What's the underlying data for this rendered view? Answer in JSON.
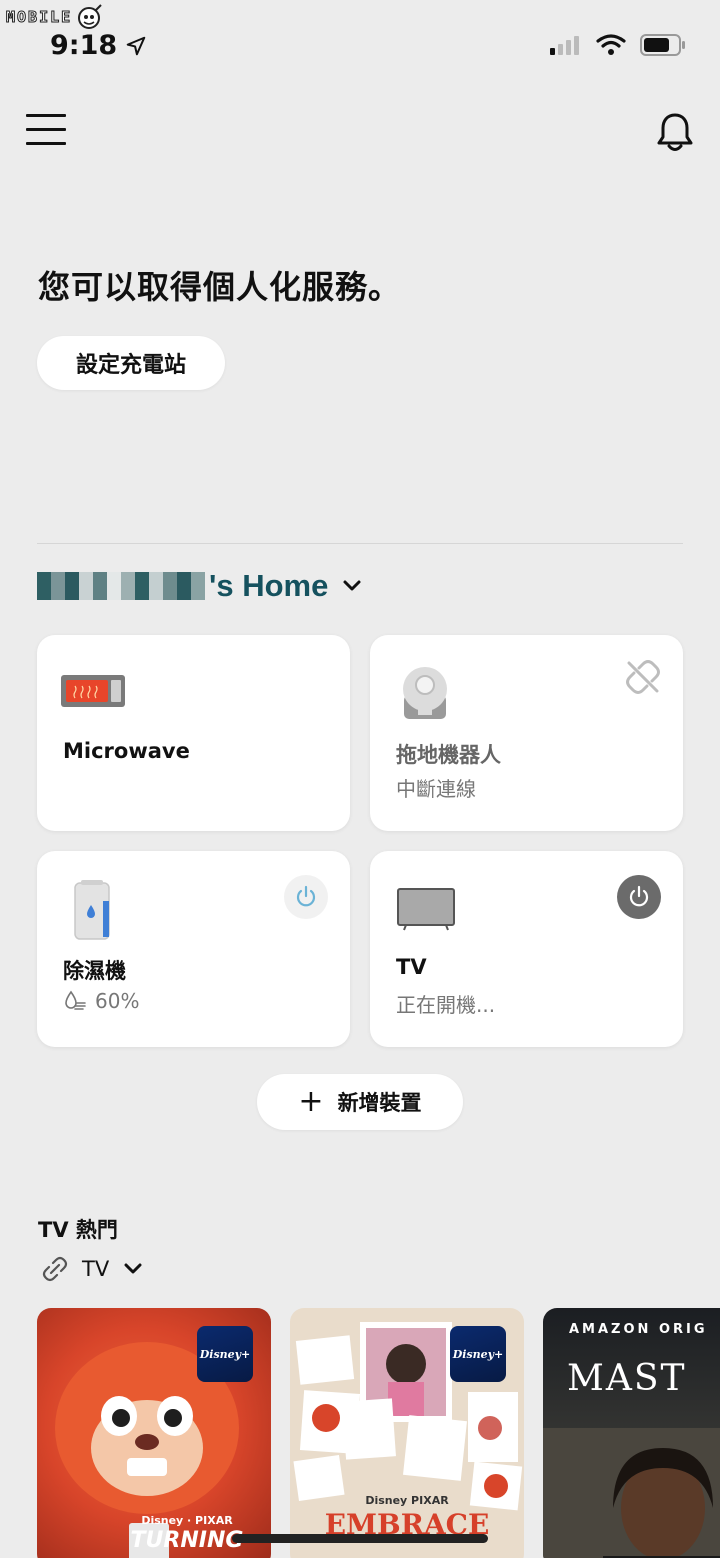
{
  "watermark": {
    "text": "MOBILE"
  },
  "status_bar": {
    "time": "9:18"
  },
  "hero": {
    "title": "您可以取得個人化服務。",
    "setup_button": "設定充電站"
  },
  "home": {
    "name": "'s Home"
  },
  "devices": [
    {
      "name": "Microwave",
      "status": ""
    },
    {
      "name": "拖地機器人",
      "status": "中斷連線"
    },
    {
      "name": "除濕機",
      "status": "60%"
    },
    {
      "name": "TV",
      "status": "正在開機..."
    }
  ],
  "add_device": {
    "label": "新增裝置",
    "icon": "plus-icon"
  },
  "tv_section": {
    "title": "TV 熱門",
    "filter": "TV",
    "thumbnails": [
      {
        "badge": "Disney+",
        "studio": "Disney · PIXAR",
        "caption": "TURNING"
      },
      {
        "badge": "Disney+",
        "studio": "Disney PIXAR",
        "caption": "EMBRACE"
      },
      {
        "header": "AMAZON ORIG",
        "caption": "MAST"
      }
    ]
  },
  "colors": {
    "background": "#ececec",
    "home_title": "#15515e",
    "card": "#ffffff"
  }
}
